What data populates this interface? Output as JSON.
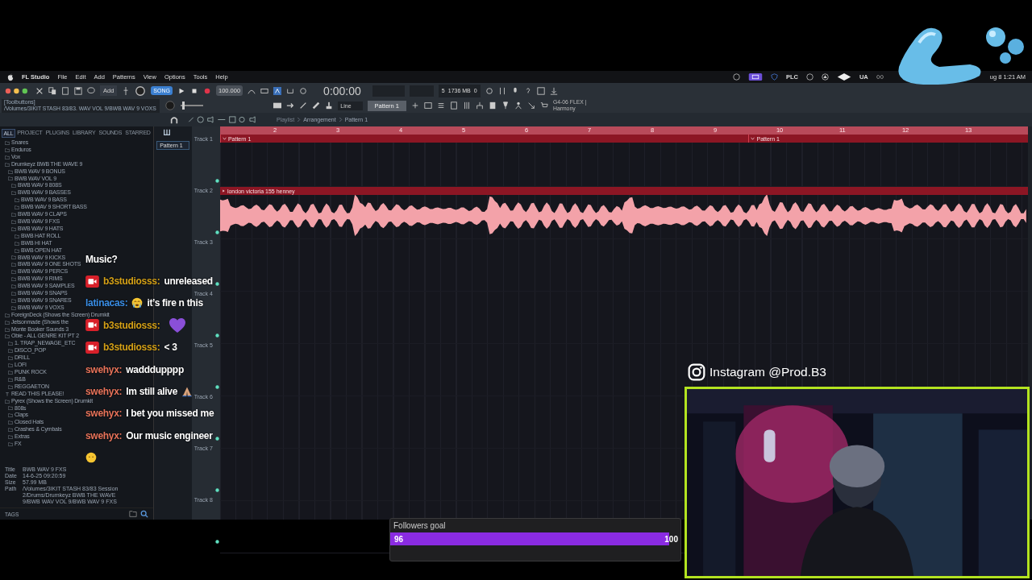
{
  "menu_bar": {
    "app": "FL Studio",
    "items": [
      "File",
      "Edit",
      "Add",
      "Patterns",
      "View",
      "Options",
      "Tools",
      "Help"
    ],
    "status_texts": [
      "PLC",
      "UA"
    ],
    "clock": "ug 8  1:21 AM"
  },
  "toolbar": {
    "hint_title": "[Toolbuttons]",
    "hint_path": "/Volumes/3IKIT STASH 83/83. WAV VOL 9/BWB WAV 9 VOXS",
    "add_label": "Add",
    "mode": "SONG",
    "tempo": "100.000",
    "time": "0:00:00",
    "cpu": "5",
    "memory": "1736 MB",
    "voices": "0",
    "volume": {
      "level": 0.08
    },
    "snap": "Line",
    "pattern": "Pattern 1",
    "news_code": "G4-06",
    "news_text": "FLEX | Harmony"
  },
  "browser": {
    "tabs": [
      {
        "label": "ALL",
        "selected": true
      },
      {
        "label": "PROJECT",
        "selected": false
      },
      {
        "label": "PLUGINS",
        "selected": false
      },
      {
        "label": "LIBRARY",
        "selected": false
      },
      {
        "label": "SOUNDS",
        "selected": false
      },
      {
        "label": "STARRED",
        "selected": false
      }
    ],
    "tree": [
      {
        "label": "Snares",
        "kind": "folder"
      },
      {
        "label": "Enduros",
        "kind": "folder"
      },
      {
        "label": "Vox",
        "kind": "folder"
      },
      {
        "label": "Drumkeyz BWB THE WAVE 9",
        "kind": "folder",
        "children": [
          {
            "label": "BWB WAV 9 BONUS",
            "kind": "folder"
          },
          {
            "label": "BWB WAV VOL 9",
            "kind": "folder",
            "children": [
              {
                "label": "BWB WAV 9 808S",
                "kind": "folder"
              },
              {
                "label": "BWB WAV 9 BASSES",
                "kind": "folder",
                "children": [
                  {
                    "label": "BWB WAV 9 BASS",
                    "kind": "folder"
                  },
                  {
                    "label": "BWB WAV 9 SHORT BASS",
                    "kind": "folder"
                  }
                ]
              },
              {
                "label": "BWB WAV 9 CLAPS",
                "kind": "folder"
              },
              {
                "label": "BWB WAV 9 FXS",
                "kind": "folder"
              },
              {
                "label": "BWB WAV 9 HATS",
                "kind": "folder",
                "children": [
                  {
                    "label": "BWB HAT ROLL",
                    "kind": "folder"
                  },
                  {
                    "label": "BWB HI HAT",
                    "kind": "folder"
                  },
                  {
                    "label": "BWB OPEN HAT",
                    "kind": "folder"
                  }
                ]
              },
              {
                "label": "BWB WAV 9 KICKS",
                "kind": "folder"
              },
              {
                "label": "BWB WAV 9 ONE SHOTS",
                "kind": "folder"
              },
              {
                "label": "BWB WAV 9 PERCS",
                "kind": "folder"
              },
              {
                "label": "BWB WAV 9 RIMS",
                "kind": "folder"
              },
              {
                "label": "BWB WAV 9 SAMPLES",
                "kind": "folder"
              },
              {
                "label": "BWB WAV 9 SNAPS",
                "kind": "folder"
              },
              {
                "label": "BWB WAV 9 SNARES",
                "kind": "folder"
              },
              {
                "label": "BWB WAV 9 VOXS",
                "kind": "folder"
              }
            ]
          }
        ]
      },
      {
        "label": "ForeignDeck (Shows the Screen) Drumkit",
        "kind": "folder"
      },
      {
        "label": "Jetsonmade (Shows the",
        "kind": "folder"
      },
      {
        "label": "Monte Booker Sounds 3",
        "kind": "folder"
      },
      {
        "label": "Obie - ALL GENRE KIT PT 2",
        "kind": "folder",
        "children": [
          {
            "label": "1. TRAP_NEWAGE_ETC",
            "kind": "folder"
          },
          {
            "label": "DISCO_POP",
            "kind": "folder"
          },
          {
            "label": "DRILL",
            "kind": "folder"
          },
          {
            "label": "LOFI",
            "kind": "folder"
          },
          {
            "label": "PUNK ROCK",
            "kind": "folder"
          },
          {
            "label": "R&B",
            "kind": "folder"
          },
          {
            "label": "REGGAETON",
            "kind": "folder"
          }
        ]
      },
      {
        "label": "READ THIS PLEASE!",
        "kind": "file"
      },
      {
        "label": "Pyrex (Shows the Screen) Drumkit",
        "kind": "folder",
        "children": [
          {
            "label": "808s",
            "kind": "folder"
          },
          {
            "label": "Claps",
            "kind": "folder"
          },
          {
            "label": "Closed Hats",
            "kind": "folder"
          },
          {
            "label": "Crashes & Cymbals",
            "kind": "folder"
          },
          {
            "label": "Extras",
            "kind": "folder"
          },
          {
            "label": "FX",
            "kind": "folder"
          }
        ]
      }
    ],
    "info": [
      {
        "key": "Title",
        "value": "BWB WAV 9 FXS"
      },
      {
        "key": "Date",
        "value": "14-6-25 09:20:59"
      },
      {
        "key": "Size",
        "value": "57.99 MB"
      },
      {
        "key": "Path",
        "value": "/Volumes/3IKIT STASH 83/83 Session 2/Drums/Drumkeyz BWB THE WAVE 9/BWB WAV VOL 9/BWB WAV 9 FXS"
      }
    ],
    "tags_label": "TAGS"
  },
  "playlist": {
    "breadcrumb": [
      "Playlist",
      "Arrangement",
      "Pattern 1"
    ],
    "patterns": [
      "Pattern 1"
    ],
    "ruler": [
      "2",
      "3",
      "4",
      "5",
      "6",
      "7",
      "8",
      "9",
      "10",
      "11",
      "12",
      "13"
    ],
    "tracks": [
      {
        "label": "Track 1",
        "clips": [
          {
            "name": "Pattern 1",
            "kind": "pattern"
          },
          {
            "name": "Pattern 1",
            "kind": "pattern"
          }
        ]
      },
      {
        "label": "Track 2",
        "clips": [
          {
            "name": "london victoria 155 henney",
            "kind": "audio"
          }
        ]
      },
      {
        "label": "Track 3"
      },
      {
        "label": "Track 4"
      },
      {
        "label": "Track 5"
      },
      {
        "label": "Track 6"
      },
      {
        "label": "Track 7"
      },
      {
        "label": "Track 8"
      }
    ]
  },
  "chat": [
    {
      "kind": "continuation",
      "text": "Music?"
    },
    {
      "kind": "text",
      "badge": true,
      "user": "b3studiosss:",
      "color": "#d4a017",
      "text": "unreleased"
    },
    {
      "kind": "crying",
      "badge": false,
      "user": "latinacas:",
      "color": "#3a8ee6",
      "text": "it’s fire n this"
    },
    {
      "kind": "heart",
      "badge": true,
      "user": "b3studiosss:",
      "color": "#d4a017"
    },
    {
      "kind": "text",
      "badge": true,
      "user": "b3studiosss:",
      "color": "#d4a017",
      "text": "< 3"
    },
    {
      "kind": "text",
      "badge": false,
      "user": "swehyx:",
      "color": "#e8735a",
      "text": "wadddupppp"
    },
    {
      "kind": "praying",
      "badge": false,
      "user": "swehyx:",
      "color": "#e8735a",
      "text": "Im still alive"
    },
    {
      "kind": "text",
      "badge": false,
      "user": "swehyx:",
      "color": "#e8735a",
      "text": "I bet you missed me"
    },
    {
      "kind": "text",
      "badge": false,
      "user": "swehyx:",
      "color": "#e8735a",
      "text": "Our music engineer"
    },
    {
      "kind": "face"
    }
  ],
  "instagram": {
    "handle": "Instagram @Prod.B3"
  },
  "followers_goal": {
    "title": "Followers goal",
    "current": "96",
    "target": "100",
    "level": 0.96
  }
}
